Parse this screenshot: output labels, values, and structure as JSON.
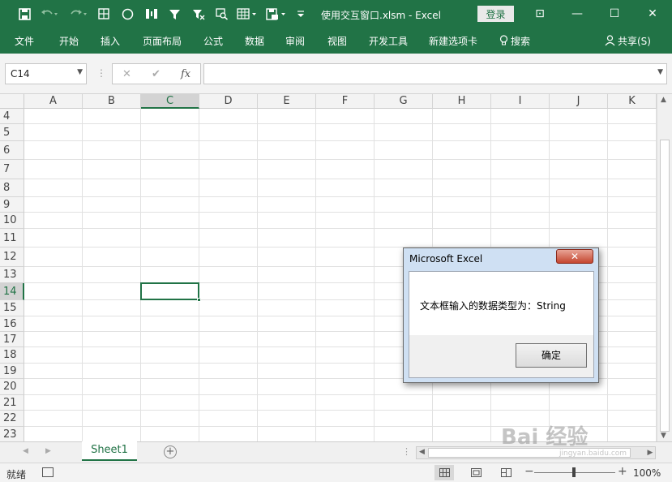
{
  "title_bar": {
    "document_title": "使用交互窗口.xlsm  -  Excel",
    "login_label": "登录",
    "qat_icons": [
      "save-icon",
      "undo-icon",
      "redo-icon",
      "borders-icon",
      "shape-icon",
      "column-icon",
      "filter-icon",
      "clear-filter-icon",
      "find-icon",
      "pivot-icon",
      "print-icon",
      "customize-icon"
    ],
    "window_controls": {
      "restore_ribbon": "⊡",
      "minimize": "—",
      "maximize": "☐",
      "close": "✕"
    }
  },
  "ribbon": {
    "tabs": [
      "文件",
      "开始",
      "插入",
      "页面布局",
      "公式",
      "数据",
      "审阅",
      "视图",
      "开发工具",
      "新建选项卡"
    ],
    "search_label": "搜索",
    "share_label": "共享(S)"
  },
  "formula_bar": {
    "name_box": "C14",
    "fx_label": "fx",
    "cancel_symbol": "✕",
    "enter_symbol": "✔",
    "value": ""
  },
  "grid": {
    "columns": [
      "A",
      "B",
      "C",
      "D",
      "E",
      "F",
      "G",
      "H",
      "I",
      "J",
      "K"
    ],
    "rows": [
      "4",
      "5",
      "6",
      "7",
      "8",
      "9",
      "10",
      "11",
      "12",
      "13",
      "14",
      "15",
      "16",
      "17",
      "18",
      "19",
      "20",
      "21",
      "22",
      "23"
    ],
    "selected_column": "C",
    "selected_row": "14"
  },
  "sheet_tabs": {
    "tabs": [
      "Sheet1"
    ],
    "add_symbol": "+"
  },
  "status_bar": {
    "status": "就绪",
    "zoom_level": "100%",
    "zoom_minus": "−",
    "zoom_plus": "+"
  },
  "msgbox": {
    "title": "Microsoft Excel",
    "message": "文本框输入的数据类型为：String",
    "ok_label": "确定",
    "close_symbol": "✕"
  },
  "watermark": {
    "text": "Bai 经验",
    "sub": "jingyan.baidu.com"
  },
  "colors": {
    "excel_green": "#217346",
    "dialog_frame": "#cfe0f3",
    "close_red": "#c4452f"
  }
}
